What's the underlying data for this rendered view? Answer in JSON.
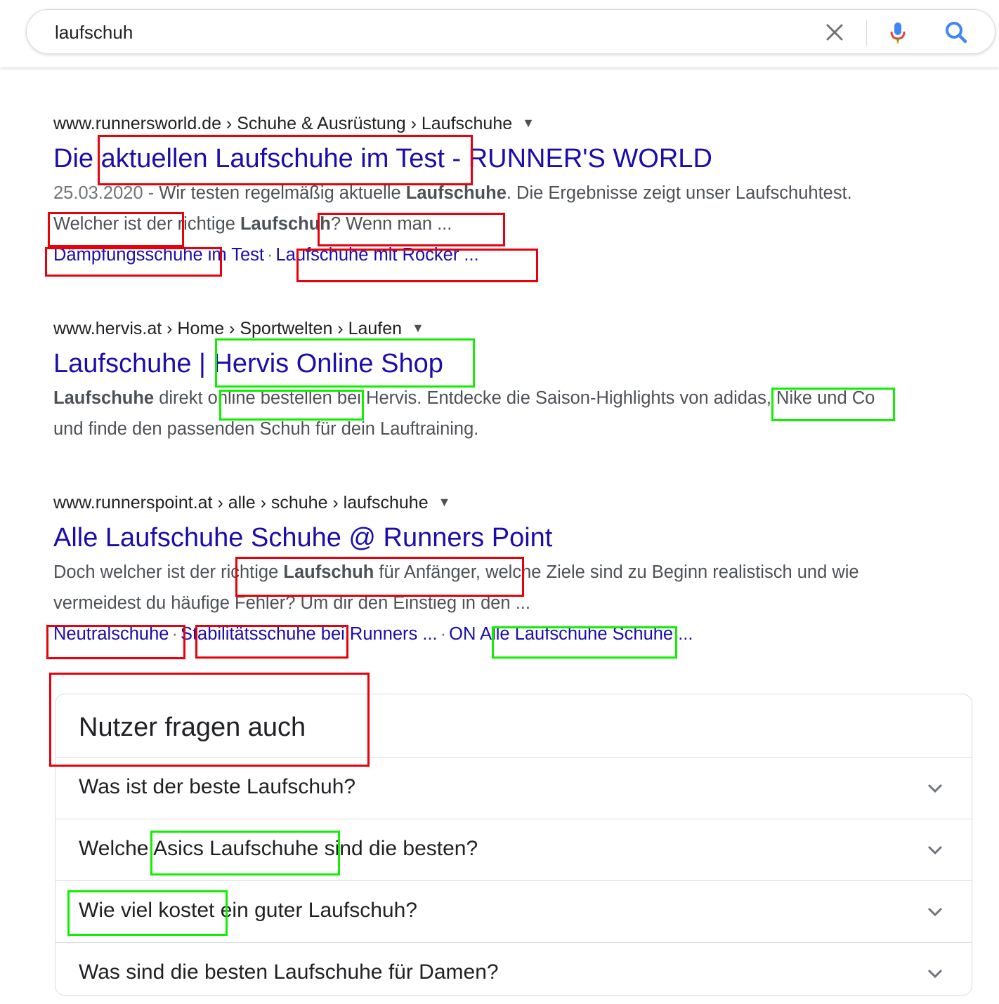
{
  "search": {
    "query": "laufschuh"
  },
  "results": [
    {
      "breadcrumb": "www.runnersworld.de › Schuhe & Ausrüstung › Laufschuhe",
      "title": "Die aktuellen Laufschuhe im Test - RUNNER'S WORLD",
      "snippet": {
        "date": "25.03.2020 - ",
        "t1": "Wir testen regelmäßig aktuelle ",
        "b1": "Laufschuhe",
        "t2": ". Die Ergebnisse zeigt unser Laufschuhtest. Welcher ist der richtige ",
        "b2": "Laufschuh",
        "t3": "? Wenn man ..."
      },
      "sitelinks": [
        "Dämpfungsschuhe im Test",
        "Laufschuhe mit Rocker ..."
      ]
    },
    {
      "breadcrumb": "www.hervis.at › Home › Sportwelten › Laufen",
      "title": "Laufschuhe | Hervis Online Shop",
      "snippet": {
        "b1": "Laufschuhe",
        "t1": " direkt online bestellen bei Hervis. Entdecke die Saison-Highlights von adidas, Nike und Co und finde den passenden Schuh für dein Lauftraining."
      }
    },
    {
      "breadcrumb": "www.runnerspoint.at › alle › schuhe › laufschuhe",
      "title": "Alle Laufschuhe Schuhe @ Runners Point",
      "snippet": {
        "t1": "Doch welcher ist der richtige ",
        "b1": "Laufschuh",
        "t2": " für Anfänger, welche Ziele sind zu Beginn realistisch und wie vermeidest du häufige Fehler? Um dir den Einstieg in den ..."
      },
      "sitelinks": [
        "Neutralschuhe",
        "Stabilitätsschuhe bei Runners ...",
        "ON Alle Laufschuhe Schuhe ..."
      ]
    }
  ],
  "people_also_ask": {
    "heading": "Nutzer fragen auch",
    "questions": [
      "Was ist der beste Laufschuh?",
      "Welche Asics Laufschuhe sind die besten?",
      "Wie viel kostet ein guter Laufschuh?",
      "Was sind die besten Laufschuhe für Damen?"
    ]
  },
  "colors": {
    "link": "#1a0dab",
    "red_box": "#e8000b",
    "green_box": "#0ff000"
  }
}
